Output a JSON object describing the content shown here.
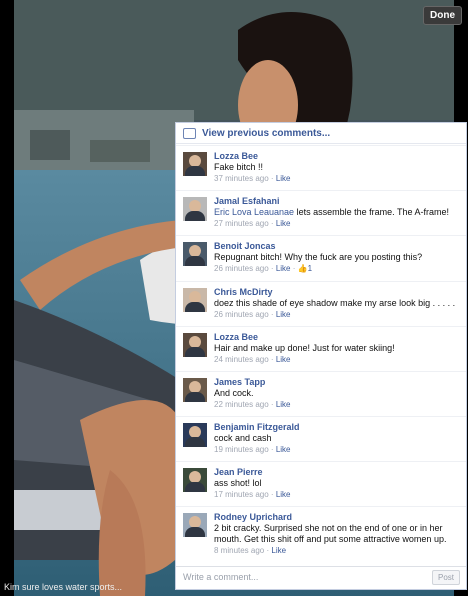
{
  "viewer": {
    "done_label": "Done",
    "caption": "Kim sure loves water sports..."
  },
  "comments_panel": {
    "view_previous": "View previous comments...",
    "write_placeholder": "Write a comment...",
    "post_label": "Post",
    "items": [
      {
        "name": "Lozza Bee",
        "mention": "",
        "text": "Fake bitch !!",
        "time": "37 minutes ago",
        "like": "Like",
        "likes": "",
        "avatar_bg": "#5a4a3e"
      },
      {
        "name": "Jamal Esfahani",
        "mention": "Eric Lova Leauanae",
        "text": " lets assemble the frame. The A-frame!",
        "time": "27 minutes ago",
        "like": "Like",
        "likes": "",
        "avatar_bg": "#b8b8b8"
      },
      {
        "name": "Benoit Joncas",
        "mention": "",
        "text": "Repugnant bitch! Why the fuck are you posting this?",
        "time": "26 minutes ago",
        "like": "Like",
        "likes": "1",
        "avatar_bg": "#4a5a6a"
      },
      {
        "name": "Chris McDirty",
        "mention": "",
        "text": "doez this shade of eye shadow make my arse look big . . . . .",
        "time": "26 minutes ago",
        "like": "Like",
        "likes": "",
        "avatar_bg": "#c9b8a8"
      },
      {
        "name": "Lozza Bee",
        "mention": "",
        "text": "Hair and make up done! Just for water skiing!",
        "time": "24 minutes ago",
        "like": "Like",
        "likes": "",
        "avatar_bg": "#5a4a3e"
      },
      {
        "name": "James Tapp",
        "mention": "",
        "text": "And cock.",
        "time": "22 minutes ago",
        "like": "Like",
        "likes": "",
        "avatar_bg": "#6a5a4a"
      },
      {
        "name": "Benjamin Fitzgerald",
        "mention": "",
        "text": "cock and cash",
        "time": "19 minutes ago",
        "like": "Like",
        "likes": "",
        "avatar_bg": "#2a3a5a"
      },
      {
        "name": "Jean Pierre",
        "mention": "",
        "text": "ass shot! lol",
        "time": "17 minutes ago",
        "like": "Like",
        "likes": "",
        "avatar_bg": "#3a4a3a"
      },
      {
        "name": "Rodney Uprichard",
        "mention": "",
        "text": "2 bit cracky. Surprised she not on the end of one or in her mouth. Get this shit off and put some attractive women up.",
        "time": "8 minutes ago",
        "like": "Like",
        "likes": "",
        "avatar_bg": "#9aa8b8"
      }
    ]
  },
  "colors": {
    "link": "#3b5998",
    "meta": "#a0a6b2",
    "background": "#000000"
  },
  "icons": [
    "comment-bubble-icon",
    "thumbs-up-icon"
  ]
}
